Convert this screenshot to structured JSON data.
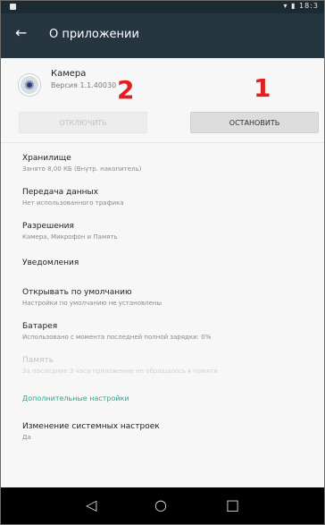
{
  "status_bar": {
    "time": "18:3"
  },
  "app_bar": {
    "title": "О приложении"
  },
  "app": {
    "name": "Камера",
    "version": "Версия 1.1.40030"
  },
  "buttons": {
    "disable": "ОТКЛЮЧИТЬ",
    "stop": "ОСТАНОВИТЬ"
  },
  "annotations": {
    "one": "1",
    "two": "2"
  },
  "settings": [
    {
      "title": "Хранилище",
      "subtitle": "Занято 8,00 КБ (Внутр. накопитель)"
    },
    {
      "title": "Передача данных",
      "subtitle": "Нет использованного трафика"
    },
    {
      "title": "Разрешения",
      "subtitle": "Камера, Микрофон и Память"
    },
    {
      "title": "Уведомления",
      "subtitle": ""
    },
    {
      "title": "Открывать по умолчанию",
      "subtitle": "Настройки по умолчанию не установлены"
    },
    {
      "title": "Батарея",
      "subtitle": "Использовано с момента последней полной зарядки: 0%"
    },
    {
      "title": "Память",
      "subtitle": "За последние 3 часа приложение не обращалось к памяти"
    }
  ],
  "section": {
    "advanced": "Дополнительные настройки"
  },
  "advanced": {
    "title": "Изменение системных настроек",
    "value": "Да"
  },
  "colors": {
    "app_bar": "#253640",
    "status_bar": "#1c2a33",
    "accent": "#2aa68f",
    "annotation": "#e02020"
  },
  "icons": {
    "back": "arrow-left-icon",
    "nav_back": "triangle-back-icon",
    "nav_home": "circle-home-icon",
    "nav_recent": "square-recents-icon"
  }
}
